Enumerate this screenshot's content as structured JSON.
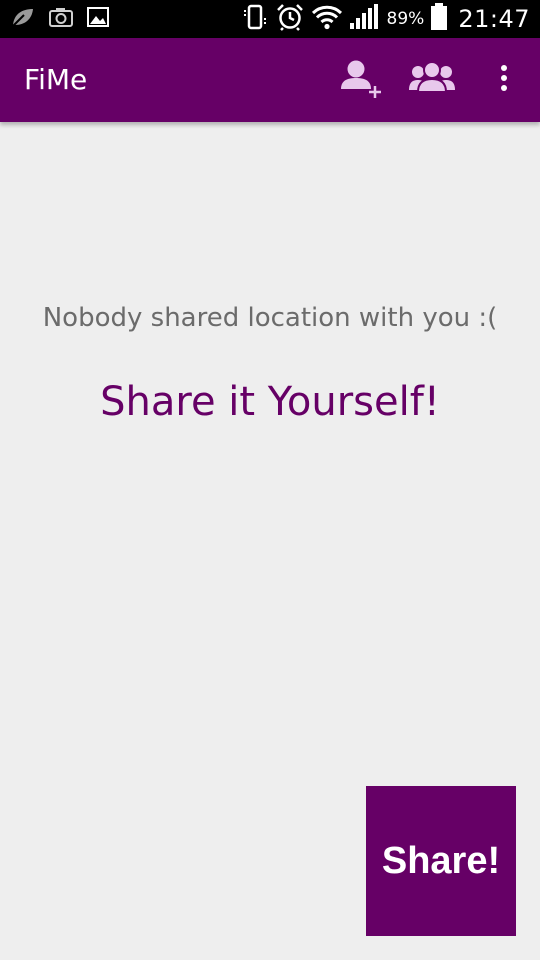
{
  "status_bar": {
    "left_icons": [
      "leaf-icon",
      "camera-icon",
      "image-icon"
    ],
    "right_icons": [
      "vibrate-icon",
      "alarm-icon",
      "wifi-icon",
      "signal-icon",
      "battery-icon"
    ],
    "battery_percent": "89%",
    "time": "21:47"
  },
  "app_bar": {
    "title": "FiMe",
    "actions": [
      "add-user-icon",
      "group-icon",
      "overflow-menu-icon"
    ],
    "background": "#660066"
  },
  "content": {
    "empty_message": "Nobody shared location with you :(",
    "call_to_action": "Share it Yourself!"
  },
  "share_button": {
    "label": "Share!",
    "background": "#660066"
  },
  "colors": {
    "accent": "#660066",
    "background": "#eeeeee",
    "muted_text": "#6b6b6b",
    "action_icon": "#e8c8ec"
  }
}
